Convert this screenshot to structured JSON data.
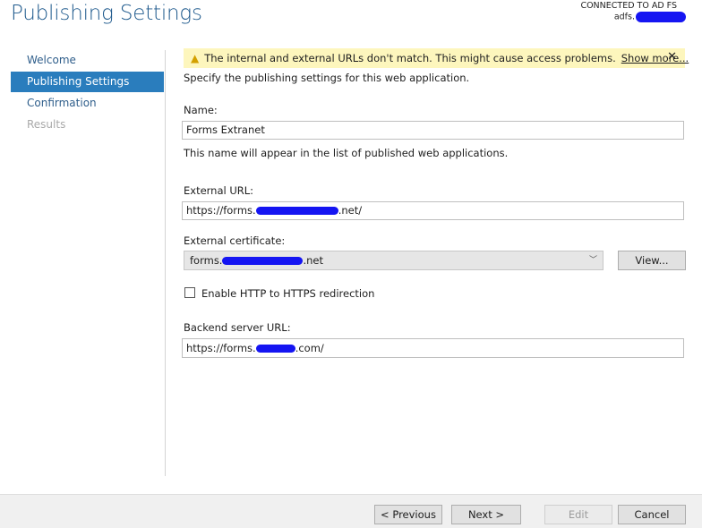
{
  "page": {
    "title": "Publishing Settings",
    "connection": {
      "label": "CONNECTED TO AD FS",
      "server": "adfs."
    }
  },
  "nav": {
    "items": [
      {
        "label": "Welcome"
      },
      {
        "label": "Publishing Settings"
      },
      {
        "label": "Confirmation"
      },
      {
        "label": "Results"
      }
    ]
  },
  "warning": {
    "message": "The internal and external URLs don't match. This might cause access problems.",
    "link": "Show more...",
    "close": "✕"
  },
  "form": {
    "intro": "Specify the publishing settings for this web application.",
    "name_label": "Name:",
    "name_value": "Forms Extranet",
    "name_hint": "This name will appear in the list of published web applications.",
    "external_url_label": "External URL:",
    "external_url_start": "https://forms.",
    "external_url_end": ".net/",
    "cert_label": "External certificate:",
    "cert_start": "forms.",
    "cert_end": ".net",
    "view_button": "View...",
    "redirect_label": "Enable HTTP to HTTPS redirection",
    "redirect_checked": false,
    "backend_label": "Backend server URL:",
    "backend_start": "https://forms.",
    "backend_end": ".com/"
  },
  "footer": {
    "previous": "< Previous",
    "next": "Next >",
    "edit": "Edit",
    "cancel": "Cancel"
  }
}
